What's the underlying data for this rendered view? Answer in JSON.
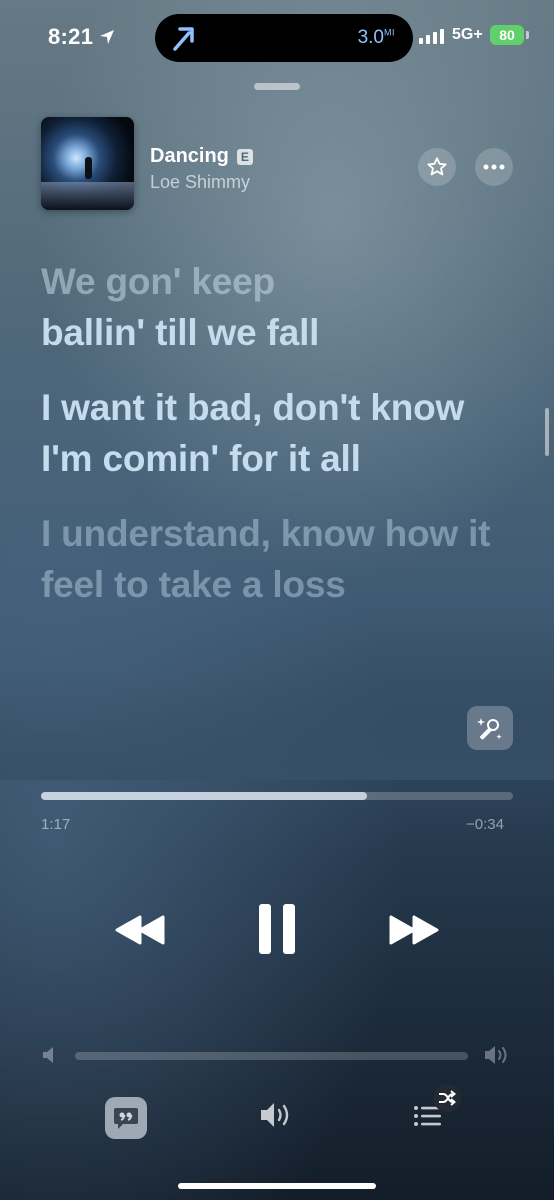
{
  "status_bar": {
    "time": "8:21",
    "nav_distance": "3.0",
    "nav_distance_unit": "MI",
    "network": "5G+",
    "battery": "80"
  },
  "now_playing": {
    "title": "Dancing",
    "explicit_badge": "E",
    "artist": "Loe Shimmy"
  },
  "lyrics": [
    {
      "text": "We gon' keep",
      "state": "past"
    },
    {
      "text": "ballin' till we fall",
      "state": "current"
    },
    {
      "text": "I want it bad, don't know I'm comin' for it all",
      "state": "current"
    },
    {
      "text": "I understand, know how it feel to take a loss",
      "state": "next"
    }
  ],
  "playback": {
    "elapsed": "1:17",
    "remaining": "−0:34",
    "progress_fraction": 0.69,
    "volume_fraction": 0.0
  },
  "colors": {
    "battery_green": "#5fd06b",
    "nav_blue": "#8ec2ff",
    "lyric_active": "#c4dcee"
  },
  "icons": [
    "location-arrow-icon",
    "turn-arrow-icon",
    "star-icon",
    "ellipsis-icon",
    "microphone-sparkle-icon",
    "rewind-icon",
    "pause-icon",
    "fast-forward-icon",
    "speaker-low-icon",
    "speaker-high-icon",
    "lyrics-quote-icon",
    "airplay-speaker-icon",
    "queue-list-icon",
    "shuffle-icon"
  ]
}
